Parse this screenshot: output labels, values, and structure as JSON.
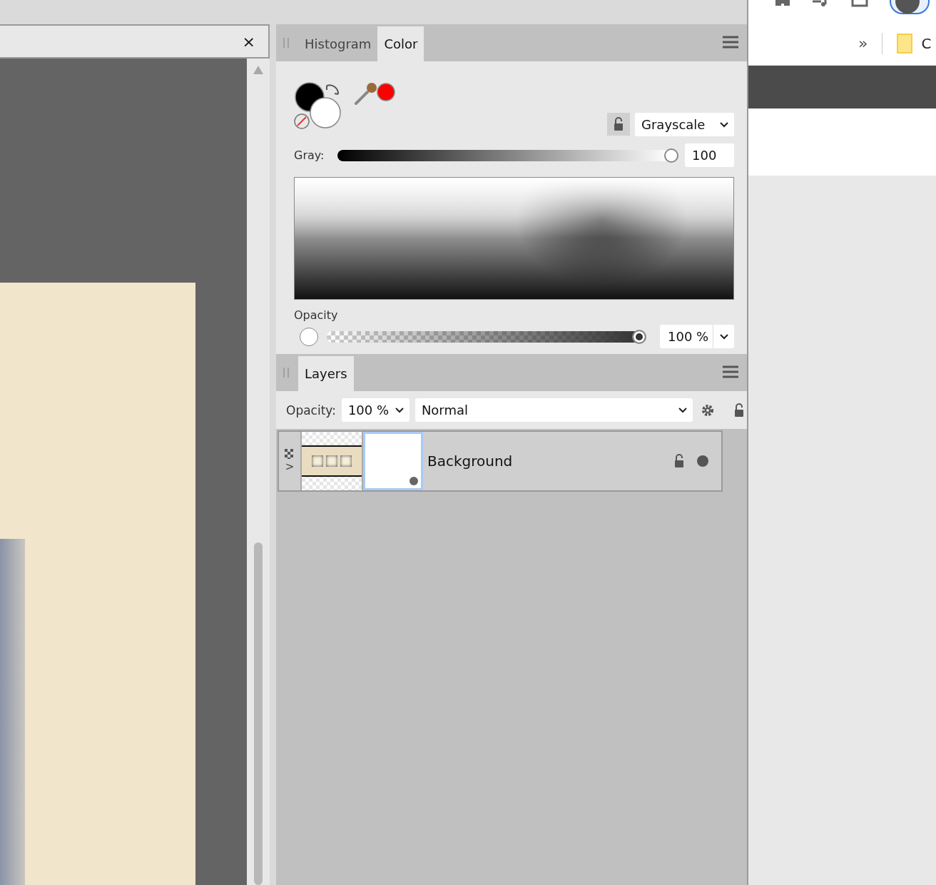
{
  "document_tab": {
    "close": "×"
  },
  "color_panel": {
    "tabs": [
      {
        "label": "Histogram",
        "selected": false
      },
      {
        "label": "Color",
        "selected": true
      }
    ],
    "mode": "Grayscale",
    "gray": {
      "label": "Gray:",
      "level": 1,
      "value": "100"
    },
    "opacity": {
      "label": "Opacity",
      "level": 1,
      "value": "100 %"
    }
  },
  "layers_panel": {
    "tabs": [
      {
        "label": "Layers",
        "selected": true
      }
    ],
    "opacity_label": "Opacity:",
    "opacity_value": "100 %",
    "blend_mode": "Normal",
    "layers": [
      {
        "name": "Background",
        "expander": ">"
      }
    ]
  },
  "browser": {
    "overflow": "»",
    "bookmark": "C"
  }
}
